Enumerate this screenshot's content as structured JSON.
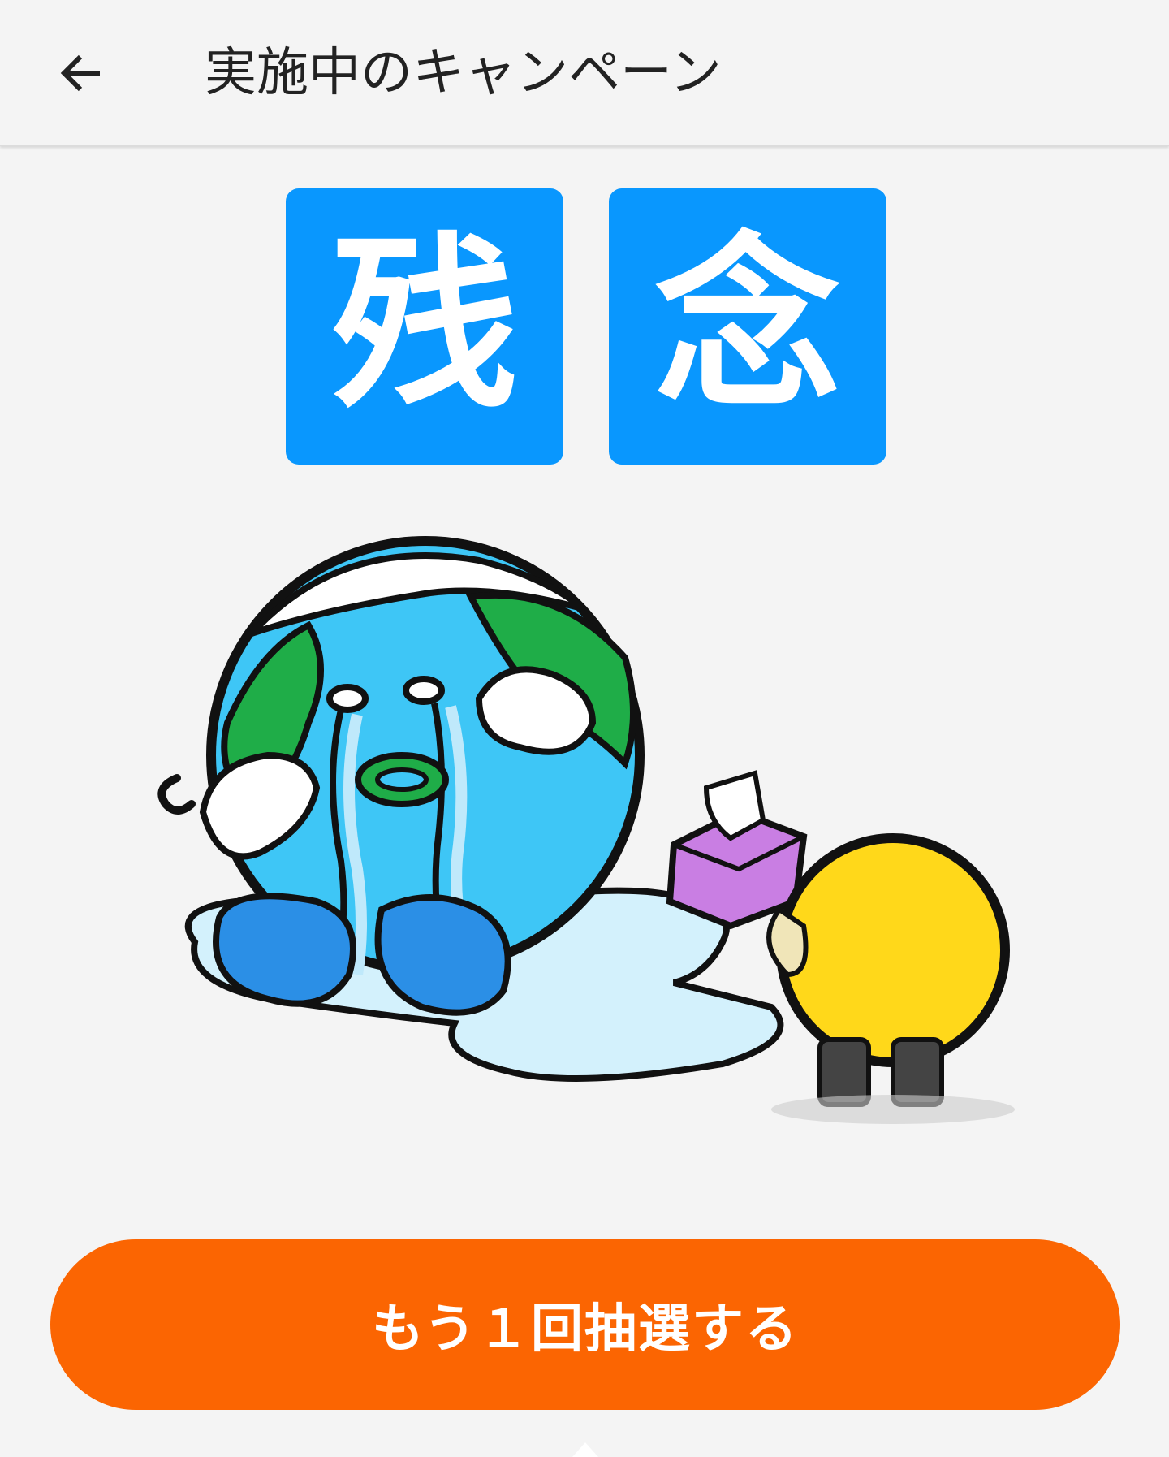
{
  "header": {
    "back_icon": "arrow-left-icon",
    "title": "実施中のキャンペーン"
  },
  "result": {
    "char_1": "残",
    "char_2": "念",
    "tile_color": "#0997fe"
  },
  "illustration": {
    "name": "crying-earth-character-illustration"
  },
  "actions": {
    "retry_label": "もう１回抽選する",
    "retry_color": "#fb6502"
  }
}
